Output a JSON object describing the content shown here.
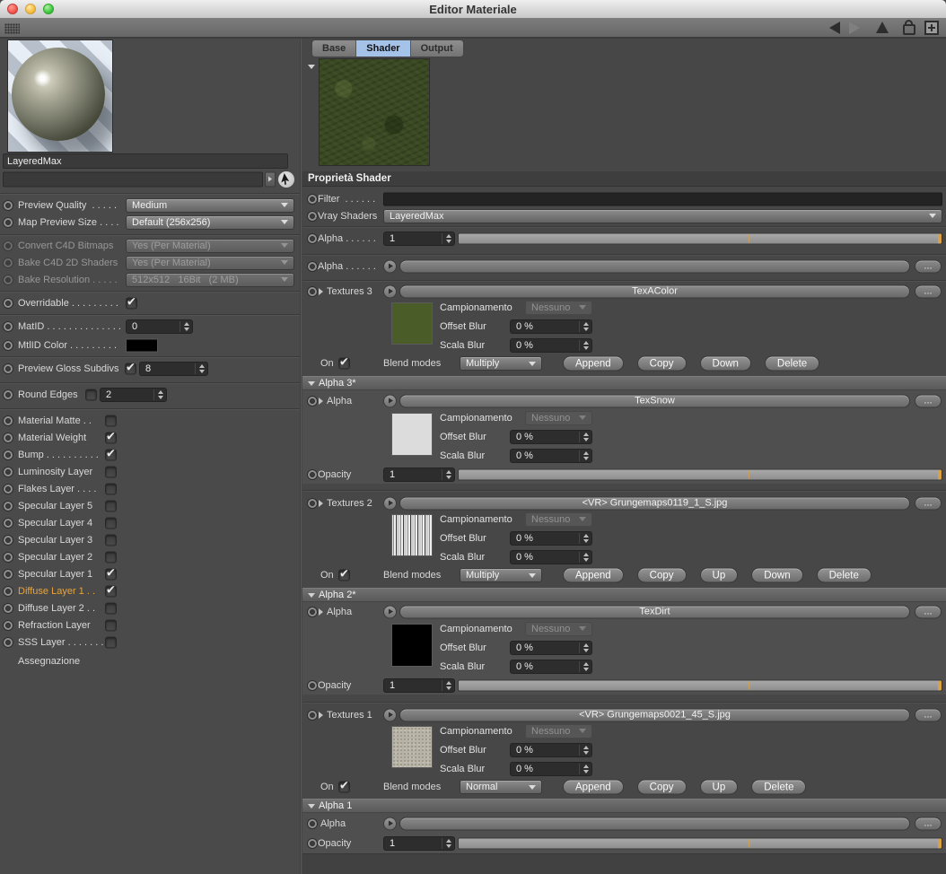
{
  "window": {
    "title": "Editor Materiale"
  },
  "tabs": {
    "base": "Base",
    "shader": "Shader",
    "output": "Output"
  },
  "left": {
    "material_name": "LayeredMax",
    "preview_quality_label": "Preview Quality  . . . . .",
    "preview_quality_value": "Medium",
    "map_preview_label": "Map Preview Size . . . .",
    "map_preview_value": "Default (256x256)",
    "convert_label": "Convert C4D Bitmaps",
    "convert_value": "Yes (Per Material)",
    "bake_shaders_label": "Bake C4D 2D Shaders",
    "bake_shaders_value": "Yes (Per Material)",
    "bake_res_label": "Bake Resolution . . . . .",
    "bake_res_value": "512x512   16Bit   (2 MB)",
    "overridable_label": "Overridable . . . . . . . . .",
    "matid_label": "MatID . . . . . . . . . . . . . .",
    "matid_value": "0",
    "mtlid_label": "MtlID Color . . . . . . . . .",
    "gloss_label": "Preview Gloss Subdivs",
    "gloss_value": "8",
    "round_label": "Round Edges",
    "round_value": "2",
    "layers": [
      {
        "label": "Material Matte . .",
        "checked": false
      },
      {
        "label": "Material Weight",
        "checked": true
      },
      {
        "label": "Bump . . . . . . . . . .",
        "checked": true
      },
      {
        "label": "Luminosity Layer",
        "checked": false
      },
      {
        "label": "Flakes Layer . . . .",
        "checked": false
      },
      {
        "label": "Specular Layer 5",
        "checked": false
      },
      {
        "label": "Specular Layer 4",
        "checked": false
      },
      {
        "label": "Specular Layer 3",
        "checked": false
      },
      {
        "label": "Specular Layer 2",
        "checked": false
      },
      {
        "label": "Specular Layer 1",
        "checked": true
      },
      {
        "label": "Diffuse Layer 1 . .",
        "checked": true
      },
      {
        "label": "Diffuse Layer 2 . .",
        "checked": false
      },
      {
        "label": "Refraction Layer",
        "checked": false
      },
      {
        "label": "SSS Layer . . . . . . .",
        "checked": false
      }
    ],
    "assegnazione": "Assegnazione"
  },
  "shader": {
    "header": "Proprietà Shader",
    "filter_label": "Filter  . . . . . .",
    "vray_label": "Vray Shaders",
    "vray_value": "LayeredMax",
    "alpha_label_dotted": "Alpha . . . . . .",
    "alpha_label": "Alpha",
    "alpha_value": "1",
    "opacity_label": "Opacity",
    "opacity_value": "1",
    "campionamento": "Campionamento",
    "nessuno": "Nessuno",
    "offset_blur": "Offset Blur",
    "scala_blur": "Scala Blur",
    "zero_pct": "0 %",
    "on": "On",
    "blend": "Blend modes",
    "dots": "...",
    "t3": {
      "label": "Textures 3",
      "value": "TexAColor",
      "blend": "Multiply",
      "buttons": [
        "Append",
        "Copy",
        "Down",
        "Delete"
      ]
    },
    "a3": {
      "header": "Alpha 3*",
      "value": "TexSnow"
    },
    "t2": {
      "label": "Textures 2",
      "value": "<VR> Grungemaps0119_1_S.jpg",
      "blend": "Multiply",
      "buttons": [
        "Append",
        "Copy",
        "Up",
        "Down",
        "Delete"
      ]
    },
    "a2": {
      "header": "Alpha 2*",
      "value": "TexDirt"
    },
    "t1": {
      "label": "Textures 1",
      "value": "<VR> Grungemaps0021_45_S.jpg",
      "blend": "Normal",
      "buttons": [
        "Append",
        "Copy",
        "Up",
        "Delete"
      ]
    },
    "a1": {
      "header": "Alpha 1"
    }
  }
}
